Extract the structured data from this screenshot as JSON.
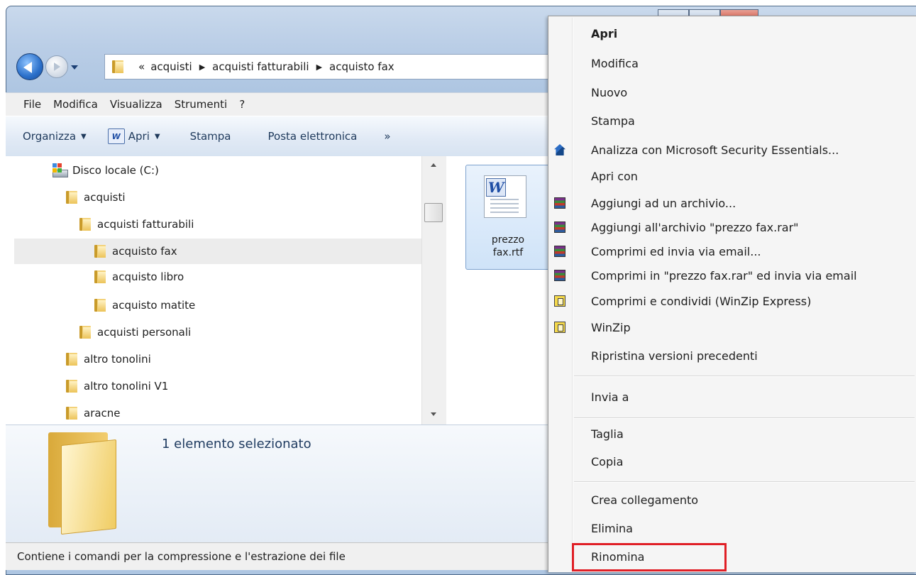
{
  "address": {
    "lead": "«",
    "crumbs": [
      "acquisti",
      "acquisti fatturabili",
      "acquisto fax"
    ]
  },
  "menubar": {
    "items": [
      "File",
      "Modifica",
      "Visualizza",
      "Strumenti",
      "?"
    ]
  },
  "commandbar": {
    "organize": "Organizza",
    "open": "Apri",
    "print": "Stampa",
    "email": "Posta elettronica",
    "more": "»"
  },
  "tree": {
    "items": [
      {
        "label": "Disco locale (C:)",
        "type": "drive"
      },
      {
        "label": "acquisti",
        "type": "folder"
      },
      {
        "label": "acquisti fatturabili",
        "type": "folder"
      },
      {
        "label": "acquisto fax",
        "type": "folder",
        "selected": true
      },
      {
        "label": "acquisto libro",
        "type": "folder"
      },
      {
        "label": "acquisto matite",
        "type": "folder"
      },
      {
        "label": "acquisti personali",
        "type": "folder"
      },
      {
        "label": "altro tonolini",
        "type": "folder"
      },
      {
        "label": "altro tonolini V1",
        "type": "folder"
      },
      {
        "label": "aracne",
        "type": "folder"
      }
    ]
  },
  "file": {
    "name_line1": "prezzo",
    "name_line2": "fax.rtf",
    "icon": "word-rtf-icon"
  },
  "details": {
    "text": "1 elemento selezionato"
  },
  "statusbar": {
    "text": "Contiene i comandi per la compressione e l'estrazione dei file"
  },
  "context_menu": {
    "items": [
      {
        "label": "Apri",
        "bold": true
      },
      {
        "label": "Modifica"
      },
      {
        "label": "Nuovo"
      },
      {
        "label": "Stampa"
      },
      {
        "label": "Analizza con Microsoft Security Essentials...",
        "icon": "security-essentials-icon"
      },
      {
        "label": "Apri con"
      },
      {
        "label": "Aggiungi ad un archivio...",
        "icon": "winrar-icon"
      },
      {
        "label": "Aggiungi all'archivio \"prezzo fax.rar\"",
        "icon": "winrar-icon"
      },
      {
        "label": "Comprimi ed invia via email...",
        "icon": "winrar-icon"
      },
      {
        "label": "Comprimi in \"prezzo fax.rar\" ed invia via email",
        "icon": "winrar-icon"
      },
      {
        "label": "Comprimi e condividi (WinZip Express)",
        "icon": "winzip-icon"
      },
      {
        "label": "WinZip",
        "icon": "winzip-icon"
      },
      {
        "label": "Ripristina versioni precedenti"
      },
      {
        "label": "Invia a"
      },
      {
        "label": "Taglia"
      },
      {
        "label": "Copia"
      },
      {
        "label": "Crea collegamento"
      },
      {
        "label": "Elimina"
      },
      {
        "label": "Rinomina",
        "highlighted": true
      }
    ]
  },
  "colors": {
    "highlight_box": "#e01f26",
    "window_frame": "#b9cde6"
  }
}
